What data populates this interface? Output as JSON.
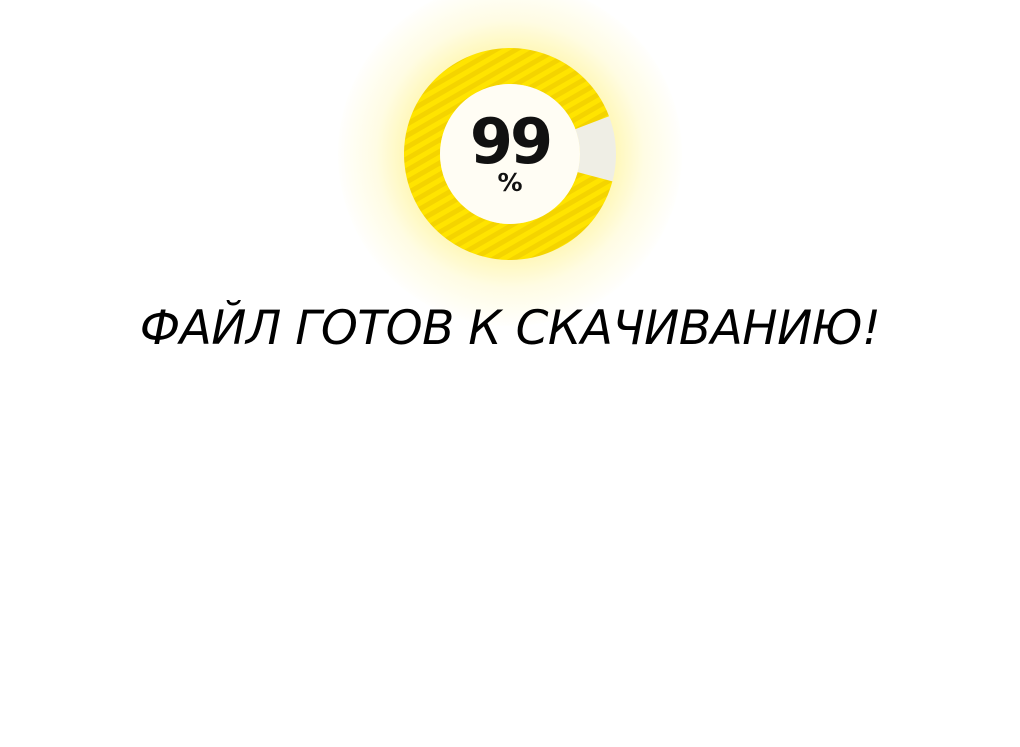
{
  "progress": {
    "value": 0.9,
    "value_label": "99",
    "unit_label": "%",
    "fill_color": "#ffe400",
    "fill_stripe_color": "#f4d400",
    "track_color": "#efeee5"
  },
  "message": {
    "text": "ФАЙЛ ГОТОВ К СКАЧИВАНИЮ!"
  }
}
